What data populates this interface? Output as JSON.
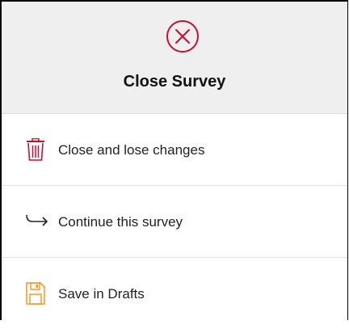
{
  "dialog": {
    "title": "Close Survey",
    "header_icon": "close-circle-icon",
    "accent_color": "#c8102e",
    "options": [
      {
        "label": "Close and lose changes",
        "icon": "trash-icon",
        "icon_color": "#c8102e"
      },
      {
        "label": "Continue this survey",
        "icon": "arrow-return-right-icon",
        "icon_color": "#222222"
      },
      {
        "label": "Save in Drafts",
        "icon": "save-disk-icon",
        "icon_color": "#f39a2e"
      }
    ]
  }
}
